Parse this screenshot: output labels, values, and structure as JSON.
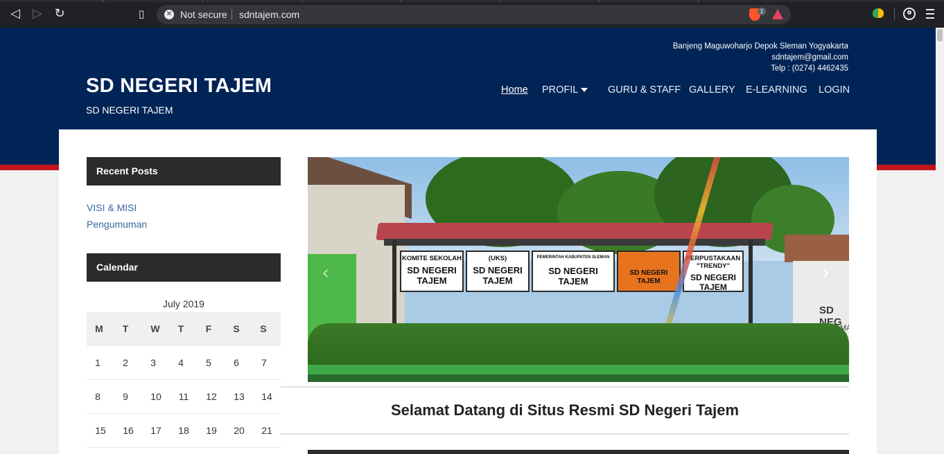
{
  "browser": {
    "security": "Not secure",
    "url": "sdntajem.com",
    "brave_badge": "1"
  },
  "header": {
    "contact": {
      "address": "Banjeng Maguwoharjo Depok Sleman Yogyakarta",
      "email": "sdntajem@gmail.com",
      "phone": "Telp : (0274) 4462435"
    },
    "site_title": "SD NEGERI TAJEM",
    "tagline": "SD NEGERI TAJEM",
    "nav": [
      "Home",
      "PROFIL",
      "GURU & STAFF",
      "GALLERY",
      "E-LEARNING",
      "LOGIN"
    ],
    "active_nav": "Home"
  },
  "sidebar": {
    "recent_posts": {
      "title": "Recent Posts",
      "items": [
        "VISI & MISI",
        "Pengumuman"
      ]
    },
    "calendar": {
      "title": "Calendar",
      "caption": "July 2019",
      "weekdays": [
        "M",
        "T",
        "W",
        "T",
        "F",
        "S",
        "S"
      ],
      "weeks": [
        [
          "1",
          "2",
          "3",
          "4",
          "5",
          "6",
          "7"
        ],
        [
          "8",
          "9",
          "10",
          "11",
          "12",
          "13",
          "14"
        ],
        [
          "15",
          "16",
          "17",
          "18",
          "19",
          "20",
          "21"
        ]
      ]
    }
  },
  "slider": {
    "boards": [
      {
        "line1": "KOMITE SEKOLAH",
        "line2": "SD NEGERI TAJEM"
      },
      {
        "line1": "(UKS)",
        "line2": "SD NEGERI TAJEM"
      },
      {
        "line1": "PEMERINTAH KABUPATEN SLEMAN",
        "line2": "SD NEGERI TAJEM"
      },
      {
        "line1": "",
        "line2": "SD NEGERI TAJEM"
      },
      {
        "line1": "PERPUSTAKAAN \"TRENDY\"",
        "line2": "SD NEGERI TAJEM"
      }
    ],
    "building_sign": "SD NEG",
    "building_sign2": "KECAMA"
  },
  "main": {
    "welcome": "Selamat Datang di Situs Resmi SD Negeri Tajem"
  },
  "colors": {
    "header_bg": "#012456",
    "accent_red": "#c4141c",
    "widget_title_bg": "#2b2b2b",
    "link": "#35689e"
  }
}
